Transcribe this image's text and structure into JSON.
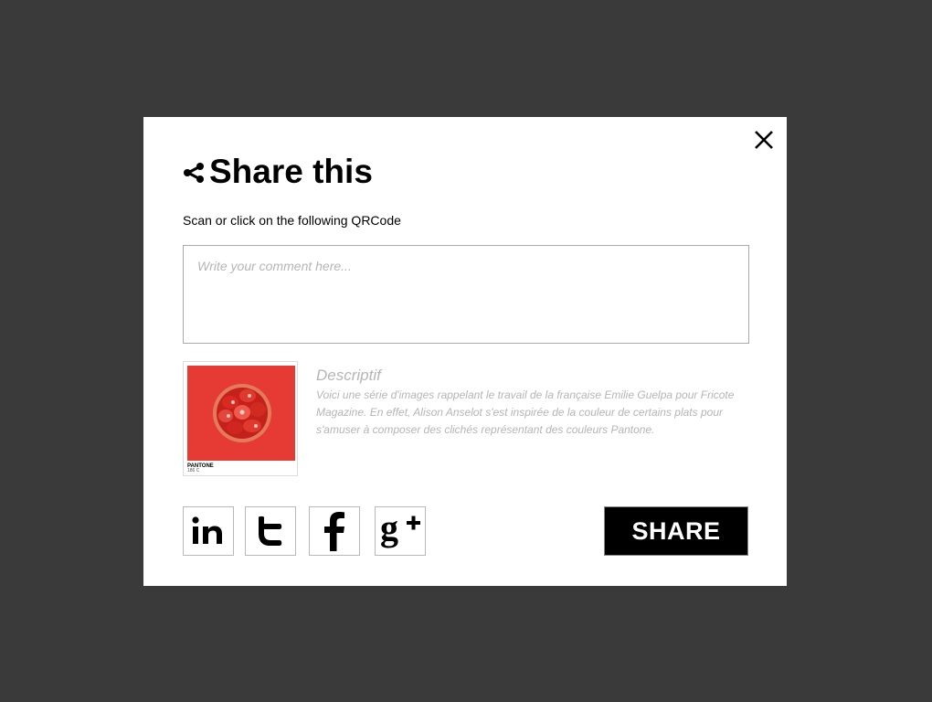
{
  "dialog": {
    "title": "Share this",
    "subtitle": "Scan or click on the following QRCode",
    "comment": {
      "value": "",
      "placeholder": "Write your comment here..."
    },
    "preview": {
      "pantone_label": "PANTONE",
      "pantone_code": "186 C",
      "image": "red-strawberry-tart-on-red-background",
      "swatch_color": "#e63b35"
    },
    "description": {
      "title": "Descriptif",
      "text": "Voici une série d'images rappelant le travail de la française Emilie Guelpa pour Fricote Magazine. En effet, Alison Anselot s'est inspirée de la couleur de certains plats pour s'amuser à composer des clichés représentant des couleurs Pantone."
    },
    "social": [
      {
        "name": "linkedin",
        "icon": "linkedin-icon"
      },
      {
        "name": "twitter",
        "icon": "twitter-icon"
      },
      {
        "name": "facebook",
        "icon": "facebook-icon"
      },
      {
        "name": "google-plus",
        "icon": "google-plus-icon"
      }
    ],
    "share_label": "SHARE"
  },
  "colors": {
    "overlay": "#3a3a3a",
    "modal": "#ffffff",
    "button": "#000000",
    "muted_text": "#b5b5b5"
  }
}
